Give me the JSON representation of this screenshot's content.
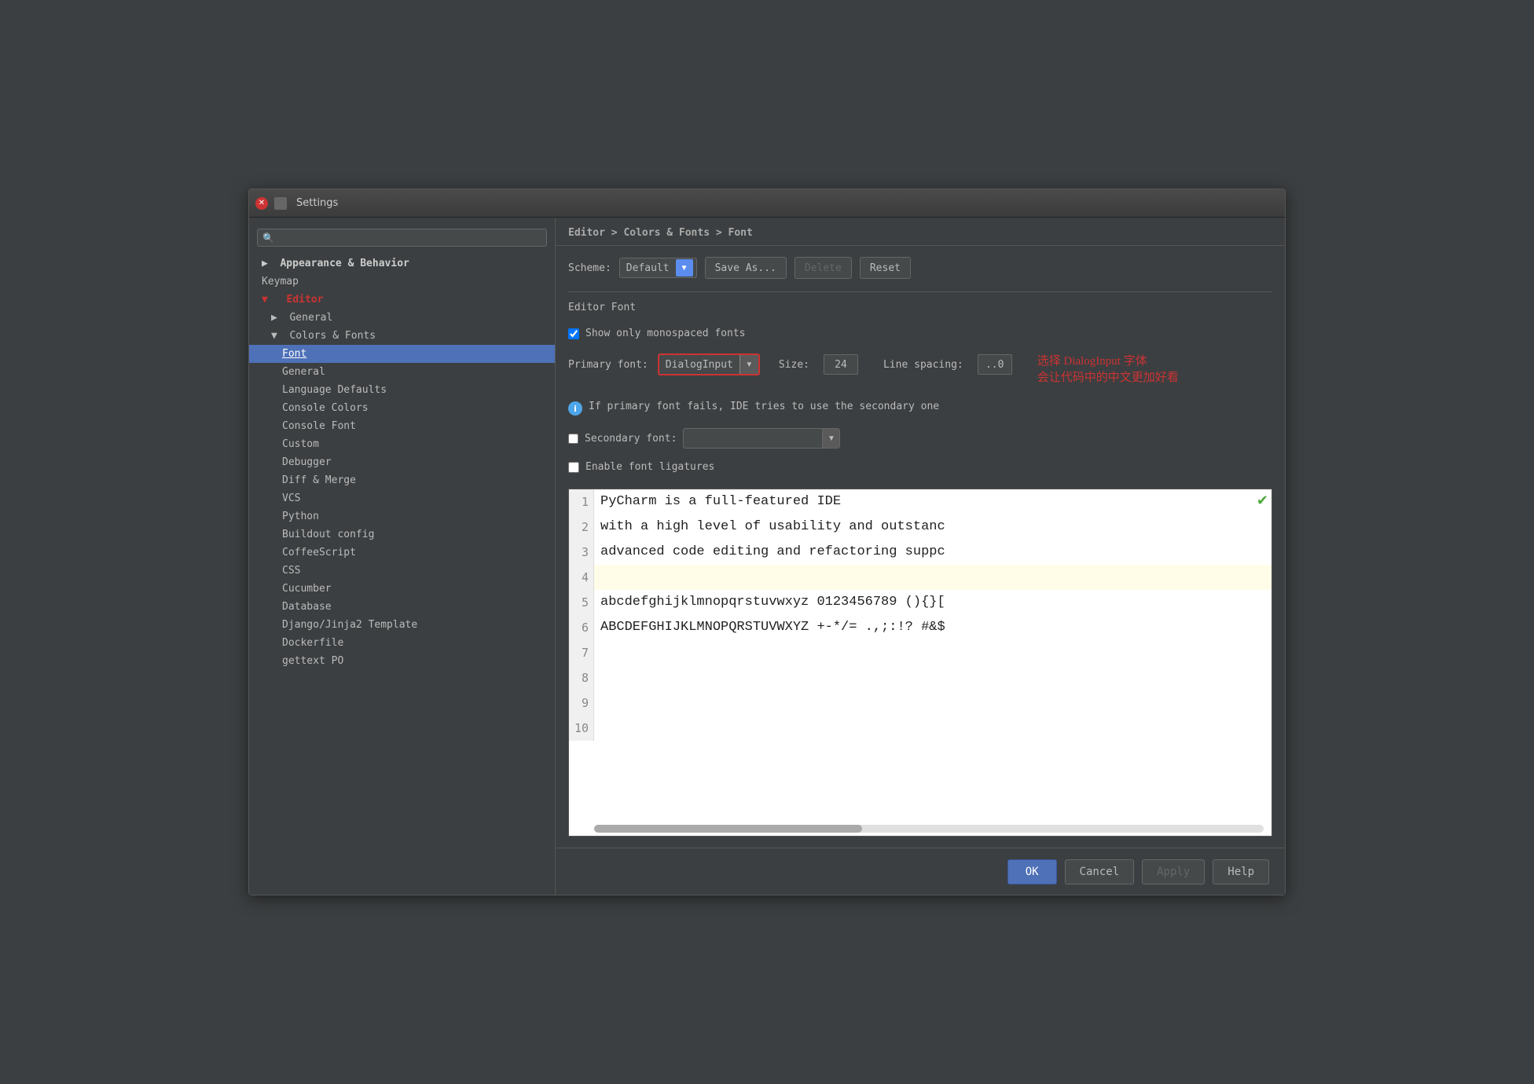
{
  "window": {
    "title": "Settings"
  },
  "breadcrumb": {
    "text": "Editor > Colors & Fonts > Font",
    "part1": "Editor",
    "sep1": " > ",
    "part2": "Colors & Fonts",
    "sep2": " > ",
    "part3": "Font"
  },
  "search": {
    "placeholder": ""
  },
  "sidebar": {
    "items": [
      {
        "label": "▶  Appearance & Behavior",
        "level": 0,
        "style": "bold header"
      },
      {
        "label": "Keymap",
        "level": 0,
        "style": "normal"
      },
      {
        "label": "▼  Editor",
        "level": 0,
        "style": "bold section red"
      },
      {
        "label": "▶  General",
        "level": 1,
        "style": "normal"
      },
      {
        "label": "▼  Colors & Fonts",
        "level": 1,
        "style": "normal"
      },
      {
        "label": "Font",
        "level": 2,
        "style": "selected"
      },
      {
        "label": "General",
        "level": 2,
        "style": "normal"
      },
      {
        "label": "Language Defaults",
        "level": 2,
        "style": "normal"
      },
      {
        "label": "Console Colors",
        "level": 2,
        "style": "normal"
      },
      {
        "label": "Console Font",
        "level": 2,
        "style": "normal"
      },
      {
        "label": "Custom",
        "level": 2,
        "style": "normal"
      },
      {
        "label": "Debugger",
        "level": 2,
        "style": "normal"
      },
      {
        "label": "Diff & Merge",
        "level": 2,
        "style": "normal"
      },
      {
        "label": "VCS",
        "level": 2,
        "style": "normal"
      },
      {
        "label": "Python",
        "level": 2,
        "style": "normal"
      },
      {
        "label": "Buildout config",
        "level": 2,
        "style": "normal"
      },
      {
        "label": "CoffeeScript",
        "level": 2,
        "style": "normal"
      },
      {
        "label": "CSS",
        "level": 2,
        "style": "normal"
      },
      {
        "label": "Cucumber",
        "level": 2,
        "style": "normal"
      },
      {
        "label": "Database",
        "level": 2,
        "style": "normal"
      },
      {
        "label": "Django/Jinja2 Template",
        "level": 2,
        "style": "normal"
      },
      {
        "label": "Dockerfile",
        "level": 2,
        "style": "normal"
      },
      {
        "label": "gettext PO",
        "level": 2,
        "style": "normal"
      }
    ]
  },
  "scheme": {
    "label": "Scheme:",
    "value": "Default",
    "buttons": {
      "save_as": "Save As...",
      "delete": "Delete",
      "reset": "Reset"
    }
  },
  "editor_font": {
    "section_label": "Editor Font",
    "show_monospaced_label": "Show only monospaced fonts",
    "show_monospaced_checked": true,
    "primary_font_label": "Primary font:",
    "primary_font_value": "DialogInput",
    "size_label": "Size:",
    "size_value": "24",
    "line_spacing_label": "Line spacing:",
    "line_spacing_value": "..0"
  },
  "info_message": "If primary font fails, IDE tries to use the secondary one",
  "secondary_font": {
    "label": "Secondary font:",
    "checked": false,
    "value": ""
  },
  "enable_ligatures": {
    "label": "Enable font ligatures",
    "checked": false
  },
  "annotation": {
    "line1": "选择 DialogInput 字体",
    "line2": "会让代码中的中文更加好看"
  },
  "preview": {
    "lines": [
      {
        "num": "1",
        "content": "PyCharm is a full-featured IDE",
        "highlight": false
      },
      {
        "num": "2",
        "content": "with a high level of usability and outstanc",
        "highlight": false
      },
      {
        "num": "3",
        "content": "advanced code editing and refactoring suppc",
        "highlight": false
      },
      {
        "num": "4",
        "content": "",
        "highlight": true
      },
      {
        "num": "5",
        "content": "abcdefghijklmnopqrstuvwxyz 0123456789 (){}[",
        "highlight": false
      },
      {
        "num": "6",
        "content": "ABCDEFGHIJKLMNOPQRSTUVWXYZ +-*/= .,;:!? #&$",
        "highlight": false
      },
      {
        "num": "7",
        "content": "",
        "highlight": false
      },
      {
        "num": "8",
        "content": "",
        "highlight": false
      },
      {
        "num": "9",
        "content": "",
        "highlight": false
      },
      {
        "num": "10",
        "content": "",
        "highlight": false
      }
    ]
  },
  "bottom_buttons": {
    "ok": "OK",
    "cancel": "Cancel",
    "apply": "Apply",
    "help": "Help"
  }
}
